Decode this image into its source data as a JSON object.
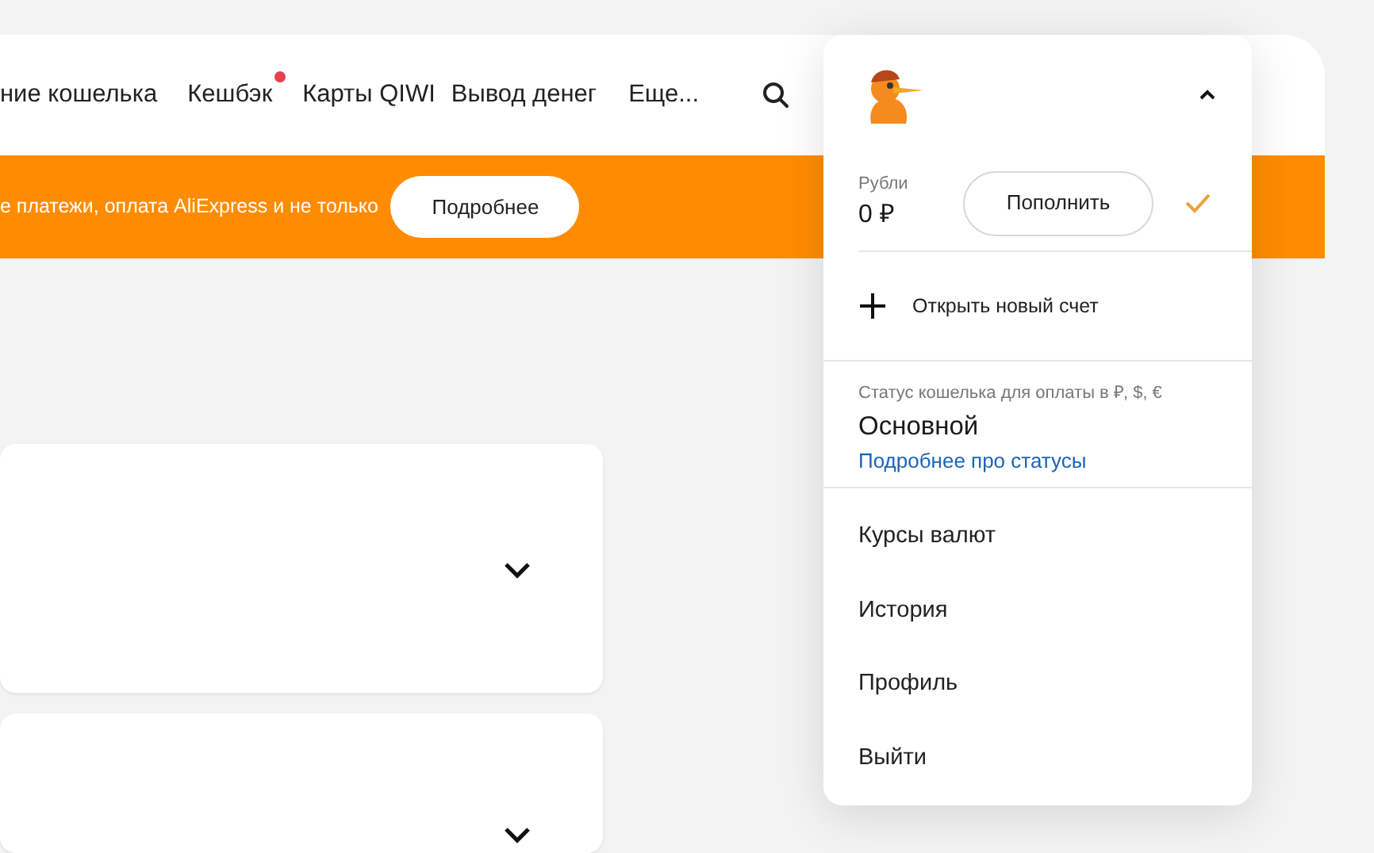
{
  "nav": [
    {
      "label": "ние кошелька",
      "notification": false
    },
    {
      "label": "Кешбэк",
      "notification": true
    },
    {
      "label": "Карты QIWI",
      "notification": false
    },
    {
      "label": "Вывод денег",
      "notification": false
    },
    {
      "label": "Еще...",
      "notification": false
    }
  ],
  "banner": {
    "text": "е платежи, оплата AliExpress и не только",
    "button": "Подробнее"
  },
  "cards": [
    {
      "expanded": false
    },
    {
      "expanded": false
    }
  ],
  "account_menu": {
    "expanded": true,
    "account": {
      "label": "Рубли",
      "amount": "0 ₽",
      "button": "Пополнить",
      "selected": true
    },
    "new_account": "Открыть новый счет",
    "status": {
      "caption": "Статус кошелька для оплаты в ₽, $, €",
      "value": "Основной",
      "link": "Подробнее про статусы"
    },
    "items": [
      "Курсы валют",
      "История",
      "Профиль",
      "Выйти"
    ]
  }
}
